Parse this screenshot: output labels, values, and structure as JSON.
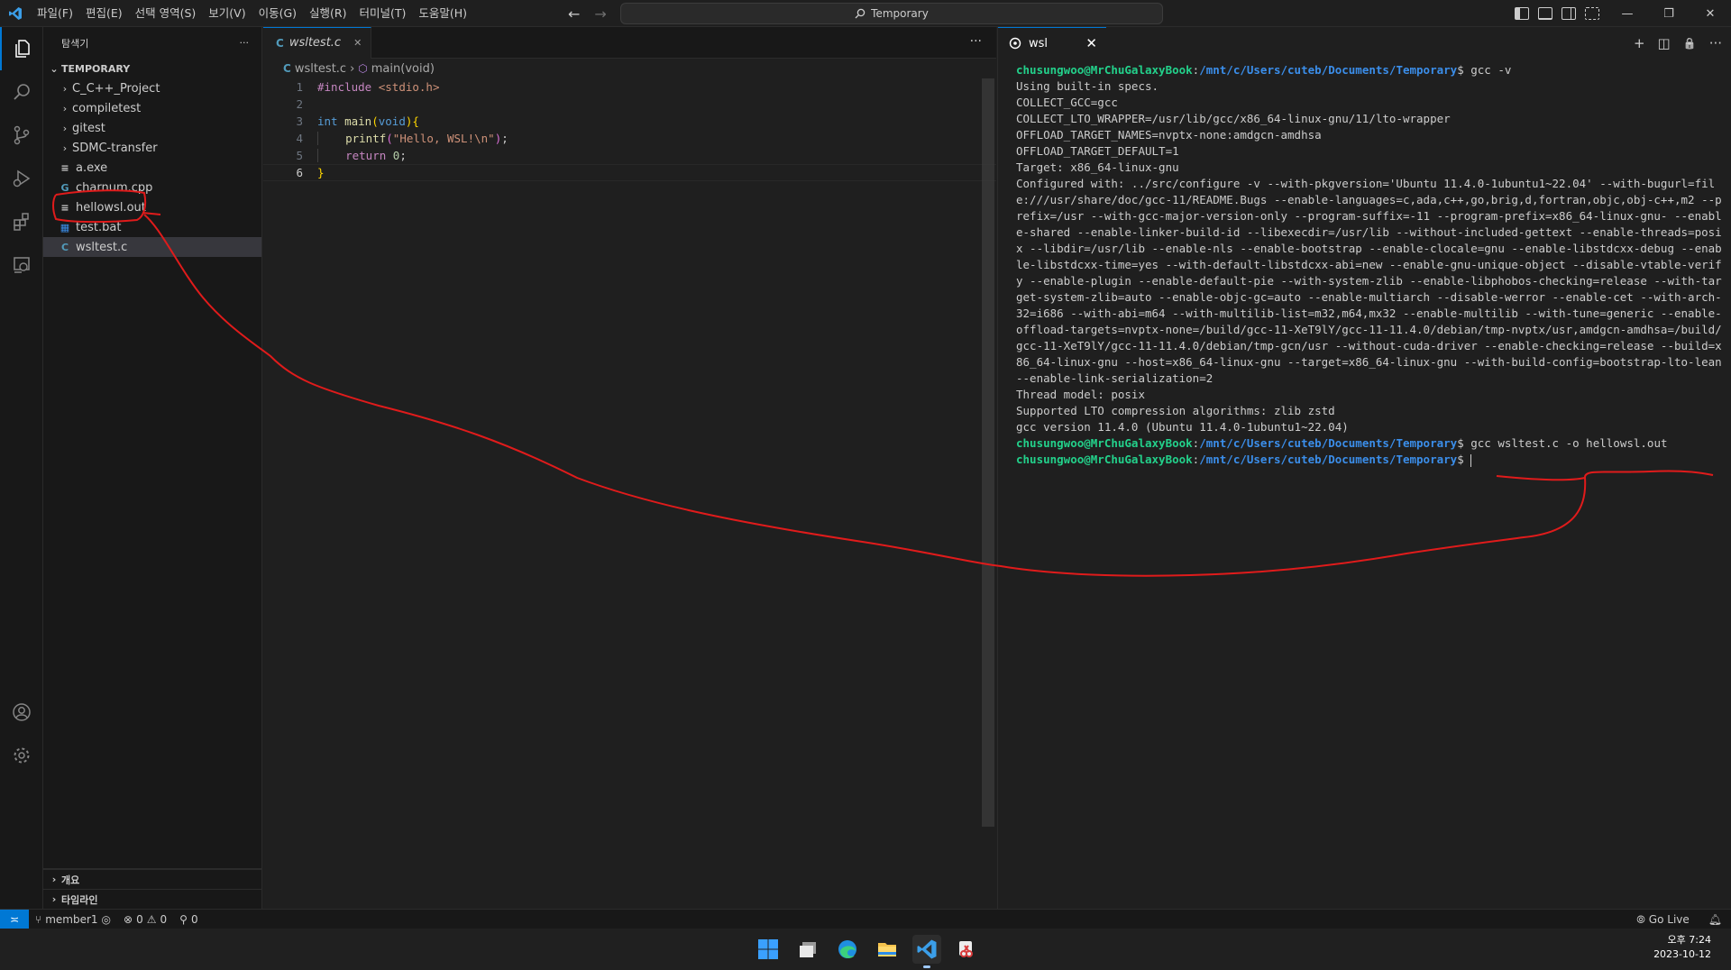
{
  "titlebar": {
    "menus": [
      "파일(F)",
      "편집(E)",
      "선택 영역(S)",
      "보기(V)",
      "이동(G)",
      "실행(R)",
      "터미널(T)",
      "도움말(H)"
    ],
    "search": "Temporary",
    "window_controls": [
      "—",
      "❐",
      "✕"
    ]
  },
  "activitybar": {
    "icons": [
      "files-icon",
      "search-icon",
      "source-control-icon",
      "run-debug-icon",
      "extensions-icon",
      "remote-explorer-icon"
    ],
    "bottom_icons": [
      "account-icon",
      "settings-gear-icon"
    ]
  },
  "sidebar": {
    "header": "탐색기",
    "more": "···",
    "folder": "TEMPORARY",
    "items": [
      {
        "label": "C_C++_Project",
        "type": "folder"
      },
      {
        "label": "compiletest",
        "type": "folder"
      },
      {
        "label": "gitest",
        "type": "folder"
      },
      {
        "label": "SDMC-transfer",
        "type": "folder"
      },
      {
        "label": "a.exe",
        "type": "file",
        "icon": "≡",
        "color": "#cccccc"
      },
      {
        "label": "charnum.cpp",
        "type": "file",
        "icon": "G",
        "color": "#519aba"
      },
      {
        "label": "hellowsl.out",
        "type": "file",
        "icon": "≡",
        "color": "#cccccc"
      },
      {
        "label": "test.bat",
        "type": "file",
        "icon": "▦",
        "color": "#3b8eea"
      },
      {
        "label": "wsltest.c",
        "type": "file",
        "icon": "C",
        "color": "#519aba",
        "selected": true
      }
    ],
    "bottom_sections": [
      "개요",
      "타임라인"
    ]
  },
  "editor": {
    "tab_label": "wsltest.c",
    "tab_icon": "C",
    "tab_close": "✕",
    "more": "···",
    "breadcrumb": {
      "file": "wsltest.c",
      "separator": "›",
      "symbol": "main(void)"
    },
    "line_numbers": [
      "1",
      "2",
      "3",
      "4",
      "5",
      "6"
    ],
    "current_line": 6,
    "code": {
      "l1_pp": "#include",
      "l1_inc": " <stdio.h>",
      "l3_int": "int",
      "l3_main": " main",
      "l3_open": "(",
      "l3_void": "void",
      "l3_close": ")",
      "l3_brace": "{",
      "l4_indent": "    ",
      "l4_fn": "printf",
      "l4_open": "(",
      "l4_str": "\"Hello, WSL!\\n\"",
      "l4_close": ")",
      "l4_semi": ";",
      "l5_indent": "    ",
      "l5_ret": "return",
      "l5_num": " 0",
      "l5_semi": ";",
      "l6_brace": "}"
    }
  },
  "terminal": {
    "tab_label": "wsl",
    "close": "✕",
    "actions": [
      "+",
      "◫",
      "🔒",
      "···"
    ],
    "prompt_user": "chusungwoo@MrChuGalaxyBook",
    "prompt_sep": ":",
    "prompt_path": "/mnt/c/Users/cuteb/Documents/Temporary",
    "prompt_end": "$ ",
    "cmd1": "gcc -v",
    "output": "Using built-in specs.\nCOLLECT_GCC=gcc\nCOLLECT_LTO_WRAPPER=/usr/lib/gcc/x86_64-linux-gnu/11/lto-wrapper\nOFFLOAD_TARGET_NAMES=nvptx-none:amdgcn-amdhsa\nOFFLOAD_TARGET_DEFAULT=1\nTarget: x86_64-linux-gnu\nConfigured with: ../src/configure -v --with-pkgversion='Ubuntu 11.4.0-1ubuntu1~22.04' --with-bugurl=file:///usr/share/doc/gcc-11/README.Bugs --enable-languages=c,ada,c++,go,brig,d,fortran,objc,obj-c++,m2 --prefix=/usr --with-gcc-major-version-only --program-suffix=-11 --program-prefix=x86_64-linux-gnu- --enable-shared --enable-linker-build-id --libexecdir=/usr/lib --without-included-gettext --enable-threads=posix --libdir=/usr/lib --enable-nls --enable-bootstrap --enable-clocale=gnu --enable-libstdcxx-debug --enable-libstdcxx-time=yes --with-default-libstdcxx-abi=new --enable-gnu-unique-object --disable-vtable-verify --enable-plugin --enable-default-pie --with-system-zlib --enable-libphobos-checking=release --with-target-system-zlib=auto --enable-objc-gc=auto --enable-multiarch --disable-werror --enable-cet --with-arch-32=i686 --with-abi=m64 --with-multilib-list=m32,m64,mx32 --enable-multilib --with-tune=generic --enable-offload-targets=nvptx-none=/build/gcc-11-XeT9lY/gcc-11-11.4.0/debian/tmp-nvptx/usr,amdgcn-amdhsa=/build/gcc-11-XeT9lY/gcc-11-11.4.0/debian/tmp-gcn/usr --without-cuda-driver --enable-checking=release --build=x86_64-linux-gnu --host=x86_64-linux-gnu --target=x86_64-linux-gnu --with-build-config=bootstrap-lto-lean --enable-link-serialization=2\nThread model: posix\nSupported LTO compression algorithms: zlib zstd\ngcc version 11.4.0 (Ubuntu 11.4.0-1ubuntu1~22.04)",
    "cmd2": "gcc wsltest.c -o hellowsl.out"
  },
  "statusbar": {
    "remote": "≍",
    "branch": "member1",
    "errors": "0",
    "warnings": "0",
    "ports": "0",
    "go_live": "Go Live"
  },
  "taskbar": {
    "apps": [
      "windows-start-icon",
      "task-view-icon",
      "edge-browser-icon",
      "file-explorer-icon",
      "vscode-icon",
      "snipping-tool-icon"
    ],
    "time": "오후 7:24",
    "date": "2023-10-12"
  },
  "annotation": {
    "color": "#e01b1b",
    "note": "hand-drawn red line connecting hellowsl.out to terminal prompt"
  }
}
